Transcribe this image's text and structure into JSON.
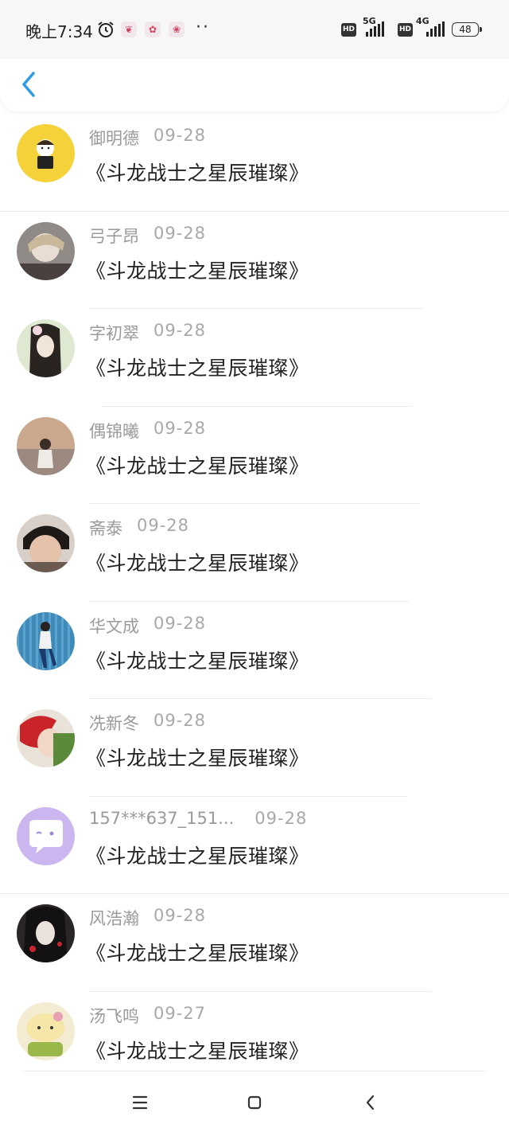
{
  "status_bar": {
    "time": "晚上7:34",
    "alarm_icon": "alarm-clock-icon",
    "notification_icons": [
      "app-notification-icon",
      "app-notification-icon",
      "app-notification-icon"
    ],
    "more_dots": "··",
    "hd_label": "HD",
    "network_1": "5G",
    "network_2": "4G",
    "battery": "48"
  },
  "nav": {
    "back_icon": "chevron-left-icon"
  },
  "items": [
    {
      "name": "御明德",
      "date": "09-28",
      "title": "《斗龙战士之星辰璀璨》"
    },
    {
      "name": "弓子昂",
      "date": "09-28",
      "title": "《斗龙战士之星辰璀璨》"
    },
    {
      "name": "字初翠",
      "date": "09-28",
      "title": "《斗龙战士之星辰璀璨》"
    },
    {
      "name": "偶锦曦",
      "date": "09-28",
      "title": "《斗龙战士之星辰璀璨》"
    },
    {
      "name": "斋泰",
      "date": "09-28",
      "title": "《斗龙战士之星辰璀璨》"
    },
    {
      "name": "华文成",
      "date": "09-28",
      "title": "《斗龙战士之星辰璀璨》"
    },
    {
      "name": "冼新冬",
      "date": "09-28",
      "title": "《斗龙战士之星辰璀璨》"
    },
    {
      "name": "157***637_151...",
      "date": "09-28",
      "title": "《斗龙战士之星辰璀璨》"
    },
    {
      "name": "风浩瀚",
      "date": "09-28",
      "title": "《斗龙战士之星辰璀璨》"
    },
    {
      "name": "汤飞鸣",
      "date": "09-27",
      "title": "《斗龙战士之星辰璀璨》"
    }
  ],
  "system_nav": {
    "menu_icon": "menu-icon",
    "home_icon": "home-square-icon",
    "back_icon": "back-triangle-icon"
  },
  "colors": {
    "accent": "#2f9be6",
    "name_gray": "#9a9a9a",
    "title_text": "#222222"
  }
}
